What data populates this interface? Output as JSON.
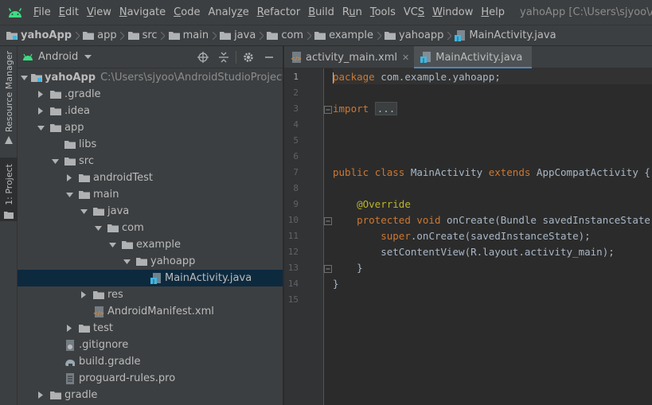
{
  "menubar": {
    "items": [
      "File",
      "Edit",
      "View",
      "Navigate",
      "Code",
      "Analyze",
      "Refactor",
      "Build",
      "Run",
      "Tools",
      "VCS",
      "Window",
      "Help"
    ],
    "underline": [
      "F",
      "E",
      "V",
      "N",
      "C",
      "z",
      "R",
      "B",
      "u",
      "T",
      "S",
      "W",
      "H"
    ],
    "window_title": "yahoApp [C:\\Users\\sjyoo\\AndroidStudioProjects\\yahoApp]"
  },
  "breadcrumb": {
    "items": [
      "yahoApp",
      "app",
      "src",
      "main",
      "java",
      "com",
      "example",
      "yahoapp",
      "MainActivity.java"
    ]
  },
  "toolstrip": {
    "resource_manager": "Resource Manager",
    "project": "1: Project"
  },
  "project_panel": {
    "view_selector": "Android",
    "tree": [
      {
        "label": "yahoApp",
        "path": "C:\\Users\\sjyoo\\AndroidStudioProjects\\yahoApp",
        "depth": 0,
        "arrow": "down",
        "icon": "module-folder"
      },
      {
        "label": ".gradle",
        "depth": 1,
        "arrow": "right",
        "icon": "folder"
      },
      {
        "label": ".idea",
        "depth": 1,
        "arrow": "right",
        "icon": "folder"
      },
      {
        "label": "app",
        "depth": 1,
        "arrow": "down",
        "icon": "folder"
      },
      {
        "label": "libs",
        "depth": 2,
        "arrow": "",
        "icon": "folder"
      },
      {
        "label": "src",
        "depth": 2,
        "arrow": "down",
        "icon": "folder"
      },
      {
        "label": "androidTest",
        "depth": 3,
        "arrow": "right",
        "icon": "folder"
      },
      {
        "label": "main",
        "depth": 3,
        "arrow": "down",
        "icon": "folder"
      },
      {
        "label": "java",
        "depth": 4,
        "arrow": "down",
        "icon": "folder"
      },
      {
        "label": "com",
        "depth": 5,
        "arrow": "down",
        "icon": "folder"
      },
      {
        "label": "example",
        "depth": 6,
        "arrow": "down",
        "icon": "folder"
      },
      {
        "label": "yahoapp",
        "depth": 7,
        "arrow": "down",
        "icon": "folder"
      },
      {
        "label": "MainActivity.java",
        "depth": 8,
        "arrow": "",
        "icon": "java-file",
        "selected": true
      },
      {
        "label": "res",
        "depth": 4,
        "arrow": "right",
        "icon": "folder"
      },
      {
        "label": "AndroidManifest.xml",
        "depth": 4,
        "arrow": "",
        "icon": "xml-file"
      },
      {
        "label": "test",
        "depth": 3,
        "arrow": "right",
        "icon": "folder"
      },
      {
        "label": ".gitignore",
        "depth": 2,
        "arrow": "",
        "icon": "gitignore-file"
      },
      {
        "label": "build.gradle",
        "depth": 2,
        "arrow": "",
        "icon": "gradle-file"
      },
      {
        "label": "proguard-rules.pro",
        "depth": 2,
        "arrow": "",
        "icon": "text-file"
      },
      {
        "label": "gradle",
        "depth": 1,
        "arrow": "right",
        "icon": "folder"
      }
    ]
  },
  "editor": {
    "tabs": [
      {
        "label": "activity_main.xml",
        "active": false,
        "icon": "xml-file"
      },
      {
        "label": "MainActivity.java",
        "active": true,
        "icon": "java-file"
      }
    ],
    "current_line": 1,
    "line_numbers": [
      "1",
      "2",
      "3",
      "4",
      "5",
      "6",
      "7",
      "8",
      "9",
      "10",
      "11",
      "12",
      "13",
      "14",
      "15"
    ],
    "lines": [
      "package com.example.yahoapp;",
      "",
      "import ...",
      "",
      "",
      "",
      "public class MainActivity extends AppCompatActivity {",
      "",
      "    @Override",
      "    protected void onCreate(Bundle savedInstanceState) {",
      "        super.onCreate(savedInstanceState);",
      "        setContentView(R.layout.activity_main);",
      "    }",
      "}",
      ""
    ]
  },
  "colors": {
    "background": "#2b2b2b",
    "panel": "#3c3f41",
    "keyword": "#cc7832",
    "annotation": "#bbb529",
    "text": "#a9b7c6",
    "selection": "#0d293e",
    "accent": "#4a88c7",
    "android_green": "#3ddc84"
  }
}
